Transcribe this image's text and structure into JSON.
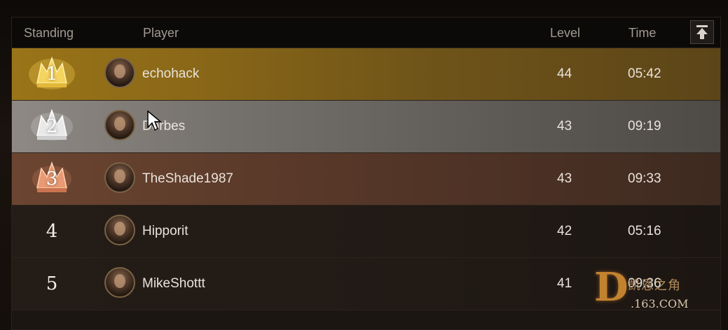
{
  "header": {
    "standing": "Standing",
    "player": "Player",
    "level": "Level",
    "time": "Time",
    "scroll_top_icon": "arrow-up-to-top-icon"
  },
  "rows": [
    {
      "standing": "1",
      "player": "echohack",
      "level": "44",
      "time": "05:42",
      "tier": "gold"
    },
    {
      "standing": "2",
      "player": "Dorbes",
      "level": "43",
      "time": "09:19",
      "tier": "silver"
    },
    {
      "standing": "3",
      "player": "TheShade1987",
      "level": "43",
      "time": "09:33",
      "tier": "bronze"
    },
    {
      "standing": "4",
      "player": "Hipporit",
      "level": "42",
      "time": "05:16",
      "tier": "plain"
    },
    {
      "standing": "5",
      "player": "MikeShottt",
      "level": "41",
      "time": "09:36",
      "tier": "plain"
    }
  ],
  "watermark": {
    "letter": "D",
    "text": "凯恩之角",
    "url": ".163.COM"
  },
  "colors": {
    "gold": "#9a7418",
    "silver": "#8e8984",
    "bronze": "#6b4531",
    "plain": "#241d17"
  }
}
